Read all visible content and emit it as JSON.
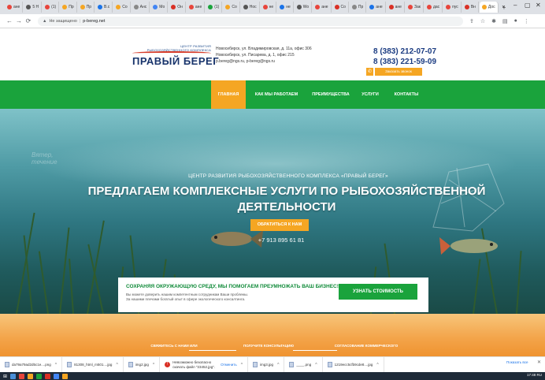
{
  "browser": {
    "tabs": [
      {
        "label": "ане",
        "color": "#e8453c"
      },
      {
        "label": "5 Н",
        "color": "#555"
      },
      {
        "label": "(1)",
        "color": "#e8453c"
      },
      {
        "label": "Пр",
        "color": "#f5a623"
      },
      {
        "label": "Пр",
        "color": "#f5a623"
      },
      {
        "label": "В.с",
        "color": "#1a73e8"
      },
      {
        "label": "Со",
        "color": "#f5a623"
      },
      {
        "label": "Анс",
        "color": "#888"
      },
      {
        "label": "Мо",
        "color": "#4285f4"
      },
      {
        "label": "Он",
        "color": "#d93025"
      },
      {
        "label": "ане",
        "color": "#e8453c"
      },
      {
        "label": "(1)",
        "color": "#1aa33c"
      },
      {
        "label": "Со",
        "color": "#f5a623"
      },
      {
        "label": "Нос",
        "color": "#555"
      },
      {
        "label": "не",
        "color": "#e8453c"
      },
      {
        "label": "не",
        "color": "#1a73e8"
      },
      {
        "label": "Wo",
        "color": "#555"
      },
      {
        "label": "ане",
        "color": "#e8453c"
      },
      {
        "label": "Со",
        "color": "#d93025"
      },
      {
        "label": "Пр",
        "color": "#888"
      },
      {
        "label": "ане",
        "color": "#1a73e8"
      },
      {
        "label": "ане",
        "color": "#d93025"
      },
      {
        "label": "Зак",
        "color": "#e8453c"
      },
      {
        "label": "дас",
        "color": "#e8453c"
      },
      {
        "label": "пус",
        "color": "#e8453c"
      },
      {
        "label": "Вн",
        "color": "#d93025"
      },
      {
        "label": "Дос",
        "color": "#f5a623"
      }
    ],
    "new_tab": "+",
    "window_controls": [
      "⌄",
      "–",
      "▢",
      "✕"
    ],
    "security_label": "Не защищено",
    "url": "p-bereg.net"
  },
  "site": {
    "logo_tagline": "ЦЕНТР РАЗВИТИЯ РЫБОХОЗЯЙСТВЕННОГО КОМПЛЕКСА",
    "logo_name": "ПРАВЫЙ БЕРЕГ",
    "address_lines": [
      "Новосибирск, ул. Владимировская, д. 11а, офис 306",
      "Новосибирск, ул. Писарева, д. 1, офис 215",
      "p.bereg@ngs.ru, p-bereg@ngs.ru"
    ],
    "phones": [
      "8 (383) 212-07-07",
      "8 (383) 221-59-09"
    ],
    "callback_label": "Заказать звонок",
    "nav": [
      "ГЛАВНАЯ",
      "КАК МЫ РАБОТАЕМ",
      "ПРЕИМУЩЕСТВА",
      "УСЛУГИ",
      "КОНТАКТЫ"
    ],
    "hero": {
      "watermark": "Вятер, течение",
      "subtitle": "ЦЕНТР РАЗВИТИЯ РЫБОХОЗЯЙСТВЕННОГО КОМПЛЕКСА «ПРАВЫЙ БЕРЕГ»",
      "title_line1": "ПРЕДЛАГАЕМ КОМПЛЕКСНЫЕ УСЛУГИ ПО РЫБОХОЗЯЙСТВЕННОЙ",
      "title_line2": "ДЕЯТЕЛЬНОСТИ",
      "button": "ОБРАТИТЬСЯ К НАМ",
      "phone": "+7 913 895 61 81"
    },
    "card": {
      "title": "СОХРАНЯЯ ОКРУЖАЮЩУЮ СРЕДУ, МЫ ПОМОГАЕМ ПРЕУМНОЖАТЬ ВАШ БИЗНЕС!",
      "text_line1": "Вы можете доверить нашим компетентным сотрудникам Ваши проблемы.",
      "text_line2": "За нашими плечами богатый опыт в сфере экологического консалтинга.",
      "button": "УЗНАТЬ СТОИМОСТЬ"
    },
    "steps": [
      "СВЯЖИТЕСЬ С НАМИ ИЛИ",
      "ПОЛУЧИТЕ КОНСУЛЬТАЦИЮ",
      "СОГЛАСОВАНИЕ КОММЕРЧЕСКОГО"
    ]
  },
  "downloads": {
    "items": [
      {
        "name": "da79a79ad2d5c1e....png"
      },
      {
        "name": "81308_html_m501....jpg"
      },
      {
        "name": "img2.jpg"
      }
    ],
    "warning_item": {
      "line1": "Невозможно безопасно",
      "line2": "скачать файл \"23452.jpg\".",
      "action": "Отменить"
    },
    "items_after": [
      {
        "name": "img3.jpg"
      },
      {
        "name": "____.png"
      },
      {
        "name": "1219ecc5cfb9cde8....jpg"
      }
    ],
    "show_all": "Показать все",
    "close": "✕"
  },
  "taskbar": {
    "apps": [
      "#4a90d9",
      "#e8453c",
      "#f5a623",
      "#1aa33c",
      "#d93025",
      "#4285f4",
      "#f5a623"
    ],
    "tray_text": "17:48  RU"
  }
}
